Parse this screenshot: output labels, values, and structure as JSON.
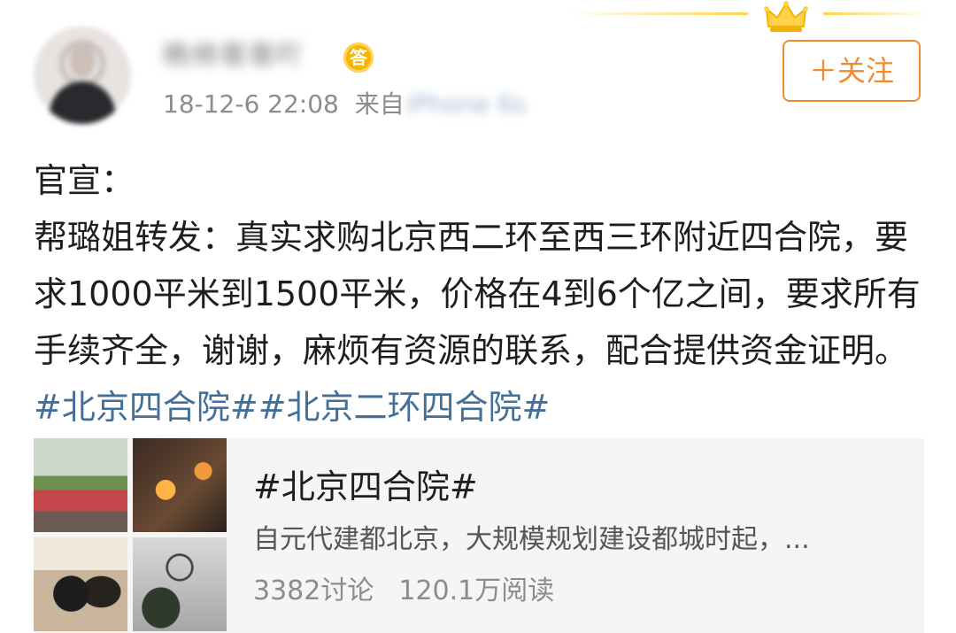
{
  "header": {
    "username": "杨帅哥哥吖",
    "badge": "答",
    "timestamp": "18-12-6 22:08",
    "source_prefix": "来自",
    "source_device": "iPhone 6s",
    "follow_label": "＋关注"
  },
  "post": {
    "line1": "官宣：",
    "body_text": "帮璐姐转发：真实求购北京西二环至西三环附近四合院，要求1000平米到1500平米，价格在4到6个亿之间，要求所有手续齐全，谢谢，麻烦有资源的联系，配合提供资金证明。",
    "hashtags": [
      "#北京四合院#",
      "#北京二环四合院#"
    ]
  },
  "topic_card": {
    "title": "#北京四合院#",
    "description": "自元代建都北京，大规模规划建设都城时起，...",
    "discussions": "3382讨论",
    "reads": "120.1万阅读"
  },
  "colors": {
    "accent_orange": "#f08c2c",
    "hashtag_blue": "#436f99",
    "badge_gold": "#f7b500"
  },
  "icons": [
    "crown-icon",
    "answer-badge-icon"
  ]
}
